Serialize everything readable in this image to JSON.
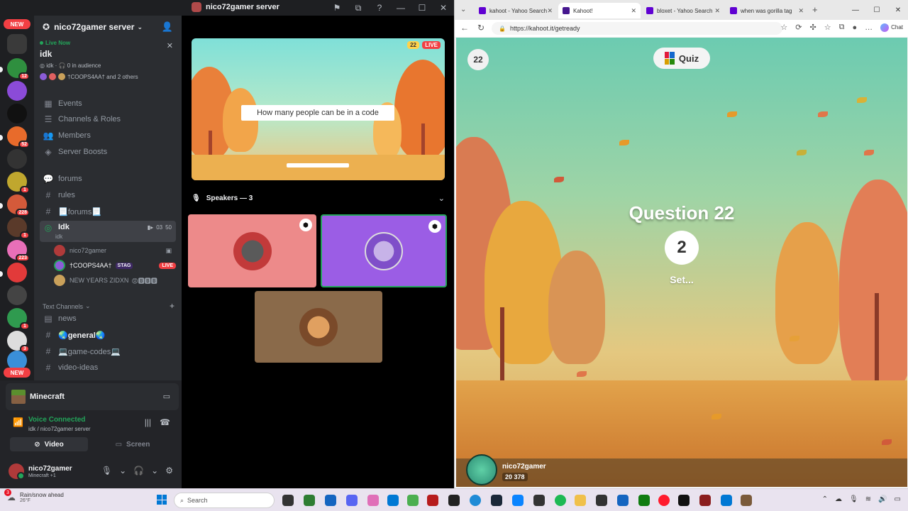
{
  "discord": {
    "window_title": "nico72gamer server",
    "server_name": "nico72gamer server",
    "rail": {
      "new_badge_top": "NEW",
      "new_badge_bottom": "NEW",
      "badges": [
        "12",
        "52",
        "1",
        "228",
        "1",
        "223",
        "1",
        "3"
      ]
    },
    "live": {
      "status": "Live Now",
      "title": "idk",
      "meta_channel": "idk",
      "audience": "0 in audience",
      "people": "†COOPS4AA† and 2 others"
    },
    "menu": [
      {
        "label": "Events",
        "icon": "calendar-icon"
      },
      {
        "label": "Channels & Roles",
        "icon": "list-icon"
      },
      {
        "label": "Members",
        "icon": "people-icon"
      },
      {
        "label": "Server Boosts",
        "icon": "boost-icon"
      }
    ],
    "channels": [
      {
        "label": "forums",
        "icon": "forum-icon"
      },
      {
        "label": "rules",
        "icon": "hash-icon"
      },
      {
        "label": "📃forums📃",
        "icon": "hash-icon"
      }
    ],
    "voice_channel": {
      "label": "Idk",
      "sub": "idk",
      "badge_video": "03",
      "badge_count": "50",
      "users": [
        {
          "name": "nico72gamer"
        },
        {
          "name": "†COOPS4AA†",
          "tag": "STAG",
          "live": "LIVE"
        },
        {
          "name": "NEW YEARS ZIDXN",
          "extra": "😡🅱🅱🅱"
        }
      ]
    },
    "text_category": "Text Channels",
    "text_channels": [
      {
        "label": "news",
        "icon": "announcement-icon"
      },
      {
        "label": "🌏general🌏",
        "icon": "hash-icon"
      },
      {
        "label": "💻game-codes💻",
        "icon": "hash-icon"
      },
      {
        "label": "video-ideas",
        "icon": "hash-icon"
      }
    ],
    "activity": {
      "name": "Minecraft"
    },
    "voice_status": {
      "connected": "Voice Connected",
      "location": "idk / nico72gamer server",
      "video_label": "Video",
      "screen_label": "Screen"
    },
    "user": {
      "name": "nico72gamer",
      "status": "Minecraft +1"
    },
    "stream": {
      "question": "How many people can be in a code",
      "count": "22",
      "live": "LIVE"
    },
    "speakers_label": "Speakers — 3"
  },
  "edge": {
    "tabs": [
      {
        "label": "kahoot - Yahoo Search",
        "color": "#6001d2"
      },
      {
        "label": "Kahoot!",
        "color": "#46178f"
      },
      {
        "label": "bloxet - Yahoo Search",
        "color": "#6001d2"
      },
      {
        "label": "when was gorilla tag",
        "color": "#6001d2"
      }
    ],
    "url": "https://kahoot.it/getready",
    "copilot_label": "Chat"
  },
  "kahoot": {
    "question_counter": "22",
    "quiz_label": "Quiz",
    "question_title": "Question 22",
    "countdown": "2",
    "status_text": "Set...",
    "player_name": "nico72gamer",
    "player_score": "20 378"
  },
  "taskbar": {
    "weather_title": "Rain/snow ahead",
    "weather_temp": "26°F",
    "weather_badge": "3",
    "search_placeholder": "Search"
  }
}
